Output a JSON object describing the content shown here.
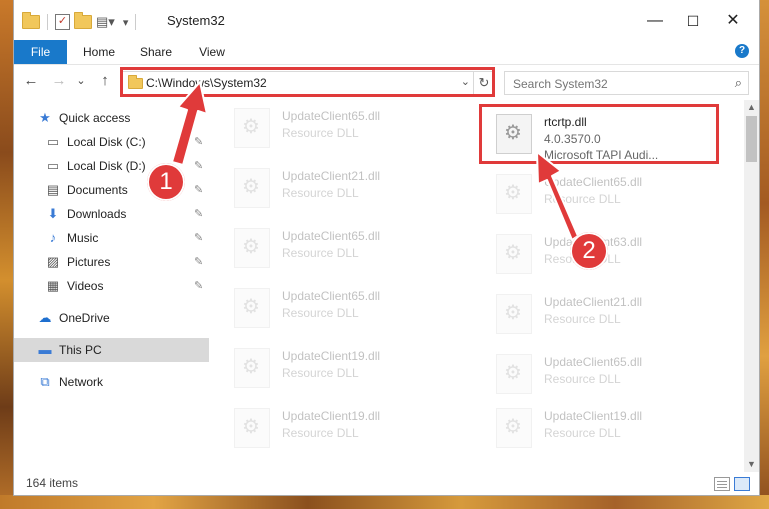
{
  "window": {
    "title": "System32",
    "controls": {
      "minimize": "—",
      "maximize": "☐",
      "close": "✕"
    }
  },
  "ribbon": {
    "tabs": [
      "File",
      "Home",
      "Share",
      "View"
    ],
    "help": "?"
  },
  "nav": {
    "back": "←",
    "forward": "→",
    "recent": "⌄",
    "up": "↑",
    "address": "C:\\Windows\\System32",
    "refresh": "↻",
    "search_placeholder": "Search System32"
  },
  "sidebar": {
    "items": [
      {
        "label": "Quick access",
        "icon": "star-icon",
        "glyph": "★",
        "color": "#3a7bd5"
      },
      {
        "label": "Local Disk (C:)",
        "icon": "drive-icon",
        "glyph": "▭",
        "color": "#666"
      },
      {
        "label": "Local Disk (D:)",
        "icon": "drive-icon",
        "glyph": "▭",
        "color": "#666"
      },
      {
        "label": "Documents",
        "icon": "documents-icon",
        "glyph": "▤",
        "color": "#555"
      },
      {
        "label": "Downloads",
        "icon": "download-icon",
        "glyph": "⬇",
        "color": "#3a7bd5"
      },
      {
        "label": "Music",
        "icon": "music-icon",
        "glyph": "♪",
        "color": "#3a7bd5"
      },
      {
        "label": "Pictures",
        "icon": "pictures-icon",
        "glyph": "▨",
        "color": "#555"
      },
      {
        "label": "Videos",
        "icon": "videos-icon",
        "glyph": "▦",
        "color": "#555"
      },
      {
        "label": "OneDrive",
        "icon": "cloud-icon",
        "glyph": "☁",
        "color": "#1e6fcf"
      },
      {
        "label": "This PC",
        "icon": "computer-icon",
        "glyph": "▬",
        "color": "#3a7bd5"
      },
      {
        "label": "Network",
        "icon": "network-icon",
        "glyph": "⧉",
        "color": "#3a7bd5"
      }
    ],
    "pin_glyph": "📌"
  },
  "files": {
    "left_column": [
      {
        "name": "UpdateClient65.dll",
        "type": "Resource DLL"
      },
      {
        "name": "UpdateClient21.dll",
        "type": "Resource DLL"
      },
      {
        "name": "UpdateClient65.dll",
        "type": "Resource DLL"
      },
      {
        "name": "UpdateClient65.dll",
        "type": "Resource DLL"
      },
      {
        "name": "UpdateClient19.dll",
        "type": "Resource DLL"
      },
      {
        "name": "UpdateClient19.dll",
        "type": "Resource DLL"
      }
    ],
    "highlighted": {
      "name": "rtcrtp.dll",
      "version": "4.0.3570.0",
      "description": "Microsoft TAPI Audi..."
    },
    "right_column": [
      {
        "name": "UpdateClient65.dll",
        "type": "Resource DLL"
      },
      {
        "name": "UpdateClient63.dll",
        "type": "Resource DLL"
      },
      {
        "name": "UpdateClient21.dll",
        "type": "Resource DLL"
      },
      {
        "name": "UpdateClient65.dll",
        "type": "Resource DLL"
      },
      {
        "name": "UpdateClient19.dll",
        "type": "Resource DLL"
      }
    ]
  },
  "status": {
    "count": "164 items"
  },
  "annotations": {
    "step1": "1",
    "step2": "2",
    "color": "#e03a3a"
  }
}
